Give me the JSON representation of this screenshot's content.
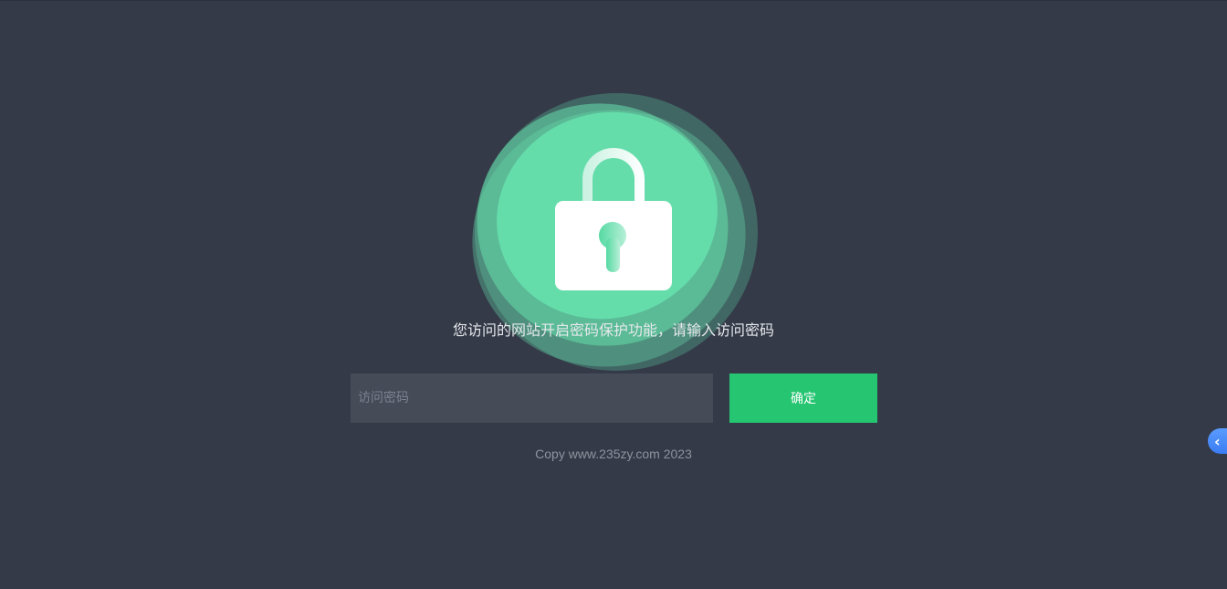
{
  "page": {
    "message": "您访问的网站开启密码保护功能，请输入访问密码",
    "password_placeholder": "访问密码",
    "password_value": "",
    "confirm_label": "确定",
    "footer": "Copy www.235zy.com 2023"
  },
  "side_tab": {
    "icon": "chevron-left-icon",
    "glyph": "‹"
  },
  "colors": {
    "background": "#343a48",
    "accent": "#25c571",
    "blob": "#66deac",
    "input_bg": "#454b57",
    "side_tab": "#4a8cf7"
  }
}
